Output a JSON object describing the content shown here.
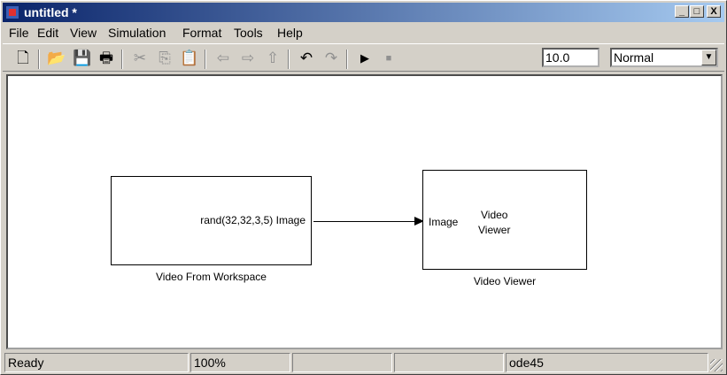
{
  "window": {
    "title": "untitled *",
    "controls": {
      "minimize": "_",
      "maximize": "□",
      "close": "X"
    }
  },
  "menubar": [
    "File",
    "Edit",
    "View",
    "Simulation",
    "Format",
    "Tools",
    "Help"
  ],
  "toolbar": {
    "icons": [
      "new-model-icon",
      "open-icon",
      "save-icon",
      "print-icon",
      "cut-icon",
      "copy-icon",
      "paste-icon",
      "back-icon",
      "forward-icon",
      "up-icon",
      "undo-icon",
      "redo-icon",
      "start-simulation-icon",
      "stop-simulation-icon"
    ],
    "stop_time": "10.0",
    "simulation_mode": "Normal"
  },
  "model": {
    "blocks": [
      {
        "name": "Video From Workspace",
        "port_text": "rand(32,32,3,5) Image"
      },
      {
        "name": "Video Viewer",
        "input_port": "Image",
        "body_text": "Video\nViewer"
      }
    ]
  },
  "statusbar": {
    "status": "Ready",
    "zoom": "100%",
    "cell3": "",
    "cell4": "",
    "solver": "ode45"
  }
}
